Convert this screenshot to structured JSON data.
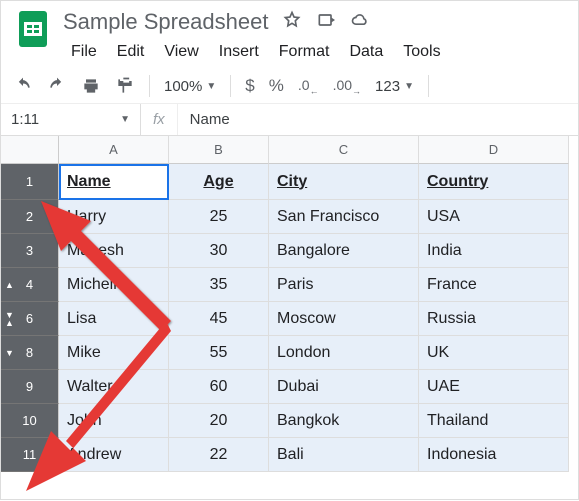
{
  "doc": {
    "title": "Sample Spreadsheet"
  },
  "menu": {
    "file": "File",
    "edit": "Edit",
    "view": "View",
    "insert": "Insert",
    "format": "Format",
    "data": "Data",
    "tools": "Tools"
  },
  "toolbar": {
    "zoom": "100%",
    "currency": "$",
    "percent": "%",
    "decdec": ".0",
    "incdec": ".00",
    "numfmt": "123"
  },
  "namebox": {
    "ref": "1:11"
  },
  "formula": {
    "fx": "fx",
    "value": "Name"
  },
  "cols": {
    "A": "A",
    "B": "B",
    "C": "C",
    "D": "D"
  },
  "rows": [
    "1",
    "2",
    "3",
    "4",
    "6",
    "8",
    "9",
    "10",
    "11"
  ],
  "chart_data": {
    "type": "table",
    "headers": [
      "Name",
      "Age",
      "City",
      "Country"
    ],
    "rows": [
      {
        "name": "Harry",
        "age": "25",
        "city": "San Francisco",
        "country": "USA"
      },
      {
        "name": "Mahesh",
        "age": "30",
        "city": "Bangalore",
        "country": "India"
      },
      {
        "name": "Michelle",
        "age": "35",
        "city": "Paris",
        "country": "France"
      },
      {
        "name": "Lisa",
        "age": "45",
        "city": "Moscow",
        "country": "Russia"
      },
      {
        "name": "Mike",
        "age": "55",
        "city": "London",
        "country": "UK"
      },
      {
        "name": "Walter",
        "age": "60",
        "city": "Dubai",
        "country": "UAE"
      },
      {
        "name": "John",
        "age": "20",
        "city": "Bangkok",
        "country": "Thailand"
      },
      {
        "name": "Andrew",
        "age": "22",
        "city": "Bali",
        "country": "Indonesia"
      }
    ]
  }
}
